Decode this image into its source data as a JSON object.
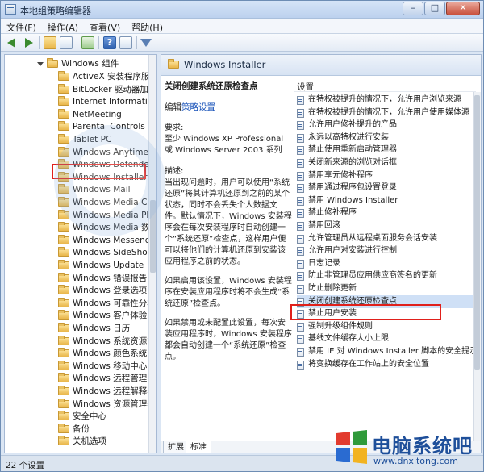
{
  "window": {
    "title": "本地组策略编辑器",
    "buttons": {
      "min": "–",
      "max": "□",
      "close": "✕"
    }
  },
  "menu": [
    "文件(F)",
    "操作(A)",
    "查看(V)",
    "帮助(H)"
  ],
  "toolbar": {
    "icons": [
      "back-arrow-icon",
      "forward-arrow-icon",
      "up-folder-icon",
      "show-tree-icon",
      "export-list-icon",
      "help-icon",
      "properties-icon",
      "filter-icon"
    ]
  },
  "tree": {
    "parent": "Windows 组件",
    "items": [
      "ActiveX 安装程序服务",
      "BitLocker 驱动器加密",
      "Internet Information",
      "NetMeeting",
      "Parental Controls",
      "Tablet PC",
      "Windows Anytime Up",
      "Windows Defender",
      "Windows Installer",
      "Windows Mail",
      "Windows Media Cen",
      "Windows Media Play",
      "Windows Media 数字",
      "Windows Messenger",
      "Windows SideShow",
      "Windows Update",
      "Windows 错误报告",
      "Windows 登录选项",
      "Windows 可靠性分析",
      "Windows 客户体验改",
      "Windows 日历",
      "Windows 系统资源管理",
      "Windows 颜色系统",
      "Windows 移动中心",
      "Windows 远程管理 (V",
      "Windows 远程解释器",
      "Windows 资源管理器",
      "安全中心",
      "备份",
      "关机选项"
    ],
    "selected_index": 8
  },
  "right": {
    "header": "Windows Installer",
    "desc": {
      "title": "关闭创建系统还原检查点",
      "edit_prefix": "编辑",
      "edit_link": "策略设置",
      "req_label": "要求:",
      "req_text": "至少 Windows XP Professional 或 Windows Server 2003 系列",
      "desc_label": "描述:",
      "p1": "当出现问题时，用户可以使用“系统还原”将其计算机还原到之前的某个状态，同时不会丢失个人数据文件。默认情况下，Windows 安装程序会在每次安装程序时自动创建一个“系统还原”检查点，这样用户便可以将他们的计算机还原到安装该应用程序之前的状态。",
      "p2": "如果启用该设置，Windows 安装程序在安装应用程序时将不会生成“系统还原”检查点。",
      "p3": "如果禁用或未配置此设置，每次安装应用程序时，Windows 安装程序都会自动创建一个“系统还原”检查点。"
    },
    "settings_header": "设置",
    "settings": [
      "在特权被提升的情况下，允许用户浏览来源",
      "在特权被提升的情况下，允许用户使用媒体源",
      "允许用户修补提升的产品",
      "永远以高特权进行安装",
      "禁止使用重新启动管理器",
      "关闭新来源的浏览对话框",
      "禁用享元修补程序",
      "禁用通过程序包设置登录",
      "禁用 Windows Installer",
      "禁止修补程序",
      "禁用回滚",
      "允许管理员从远程桌面服务会话安装",
      "允许用户对安装进行控制",
      "日志记录",
      "防止非管理员应用供应商签名的更新",
      "防止删除更新",
      "关闭创建系统还原检查点",
      "禁止用户安装",
      "强制升级组件规则",
      "基线文件缓存大小上限",
      "禁用 IE 对 Windows Installer 脚本的安全提示",
      "将变换缓存在工作站上的安全位置"
    ],
    "selected_index": 16,
    "tabs": [
      "扩展",
      "标准"
    ]
  },
  "status": {
    "text": "22 个设置"
  },
  "watermark": {
    "brand": "电脑系统吧",
    "url": "www.dnxitong.com",
    "colors": [
      "#e23b2e",
      "#2f9a3a",
      "#2a6bd1",
      "#f2b321"
    ]
  }
}
